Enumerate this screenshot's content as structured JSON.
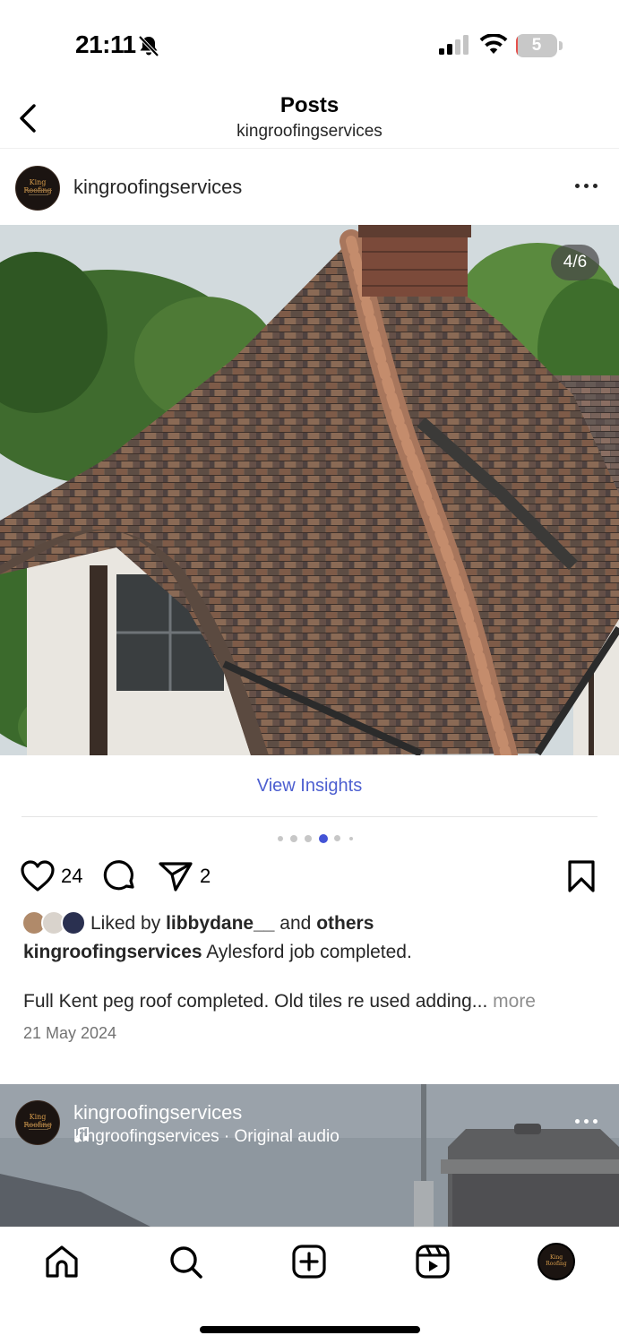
{
  "status_bar": {
    "time": "21:11",
    "battery_level": "5",
    "icons": [
      "bell-slash-icon",
      "signal-icon",
      "wifi-icon",
      "battery-icon"
    ]
  },
  "header": {
    "title": "Posts",
    "subtitle": "kingroofingservices",
    "back_icon": "chevron-left-icon"
  },
  "post": {
    "username": "kingroofingservices",
    "avatar_text": "King Roofing",
    "image_counter": "4/6",
    "image_subject": "tiled roof with chimney and trees",
    "view_insights": "View Insights",
    "carousel": {
      "total_dots": 6,
      "active_index": 3
    },
    "actions": {
      "like_count": "24",
      "share_count": "2"
    },
    "liked_by": {
      "prefix": "Liked by",
      "user": "libbydane__",
      "and": "and",
      "others": "others"
    },
    "caption": {
      "username": "kingroofingservices",
      "text": "Aylesford job completed.",
      "second_line": "Full Kent peg roof completed. Old tiles re used adding...",
      "more": "more"
    },
    "date": "21 May 2024"
  },
  "post2": {
    "username": "kingroofingservices",
    "audio": "kingroofingservices · Original audio"
  },
  "bottom_nav": {
    "items": [
      "home-icon",
      "search-icon",
      "create-icon",
      "reels-icon",
      "profile-avatar"
    ]
  },
  "colors": {
    "link": "#4d5fd0",
    "active_dot": "#4353d6",
    "battery_low": "#e5514c"
  }
}
